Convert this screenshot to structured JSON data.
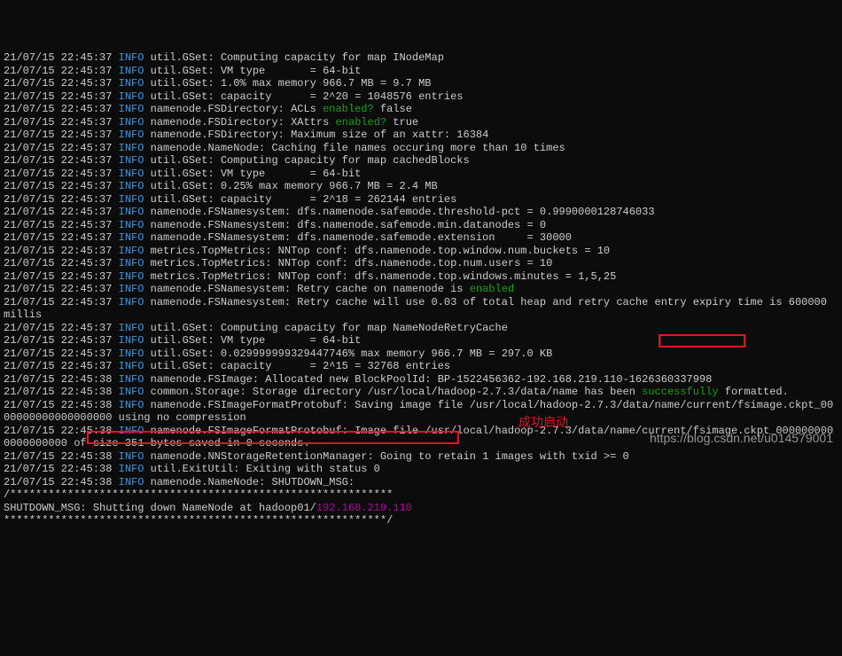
{
  "lines": [
    {
      "ts": "21/07/15 22:45:37",
      "lvl": "INFO",
      "msg": "util.GSet: Computing capacity for map INodeMap"
    },
    {
      "ts": "21/07/15 22:45:37",
      "lvl": "INFO",
      "msg": "util.GSet: VM type       = 64-bit"
    },
    {
      "ts": "21/07/15 22:45:37",
      "lvl": "INFO",
      "msg": "util.GSet: 1.0% max memory 966.7 MB = 9.7 MB"
    },
    {
      "ts": "21/07/15 22:45:37",
      "lvl": "INFO",
      "msg": "util.GSet: capacity      = 2^20 = 1048576 entries"
    },
    {
      "ts": "21/07/15 22:45:37",
      "lvl": "INFO",
      "msg_parts": [
        "namenode.FSDirectory: ACLs ",
        {
          "kw": "enabled?"
        },
        " false"
      ]
    },
    {
      "ts": "21/07/15 22:45:37",
      "lvl": "INFO",
      "msg_parts": [
        "namenode.FSDirectory: XAttrs ",
        {
          "kw": "enabled?"
        },
        " true"
      ]
    },
    {
      "ts": "21/07/15 22:45:37",
      "lvl": "INFO",
      "msg": "namenode.FSDirectory: Maximum size of an xattr: 16384"
    },
    {
      "ts": "21/07/15 22:45:37",
      "lvl": "INFO",
      "msg": "namenode.NameNode: Caching file names occuring more than 10 times"
    },
    {
      "ts": "21/07/15 22:45:37",
      "lvl": "INFO",
      "msg": "util.GSet: Computing capacity for map cachedBlocks"
    },
    {
      "ts": "21/07/15 22:45:37",
      "lvl": "INFO",
      "msg": "util.GSet: VM type       = 64-bit"
    },
    {
      "ts": "21/07/15 22:45:37",
      "lvl": "INFO",
      "msg": "util.GSet: 0.25% max memory 966.7 MB = 2.4 MB"
    },
    {
      "ts": "21/07/15 22:45:37",
      "lvl": "INFO",
      "msg": "util.GSet: capacity      = 2^18 = 262144 entries"
    },
    {
      "ts": "21/07/15 22:45:37",
      "lvl": "INFO",
      "msg": "namenode.FSNamesystem: dfs.namenode.safemode.threshold-pct = 0.9990000128746033"
    },
    {
      "ts": "21/07/15 22:45:37",
      "lvl": "INFO",
      "msg": "namenode.FSNamesystem: dfs.namenode.safemode.min.datanodes = 0"
    },
    {
      "ts": "21/07/15 22:45:37",
      "lvl": "INFO",
      "msg": "namenode.FSNamesystem: dfs.namenode.safemode.extension     = 30000"
    },
    {
      "ts": "21/07/15 22:45:37",
      "lvl": "INFO",
      "msg": "metrics.TopMetrics: NNTop conf: dfs.namenode.top.window.num.buckets = 10"
    },
    {
      "ts": "21/07/15 22:45:37",
      "lvl": "INFO",
      "msg": "metrics.TopMetrics: NNTop conf: dfs.namenode.top.num.users = 10"
    },
    {
      "ts": "21/07/15 22:45:37",
      "lvl": "INFO",
      "msg": "metrics.TopMetrics: NNTop conf: dfs.namenode.top.windows.minutes = 1,5,25"
    },
    {
      "ts": "21/07/15 22:45:37",
      "lvl": "INFO",
      "msg_parts": [
        "namenode.FSNamesystem: Retry cache on namenode is ",
        {
          "kw": "enabled"
        }
      ]
    },
    {
      "ts": "21/07/15 22:45:37",
      "lvl": "INFO",
      "msg": "namenode.FSNamesystem: Retry cache will use 0.03 of total heap and retry cache entry expiry time is 600000 millis"
    },
    {
      "ts": "21/07/15 22:45:37",
      "lvl": "INFO",
      "msg": "util.GSet: Computing capacity for map NameNodeRetryCache"
    },
    {
      "ts": "21/07/15 22:45:37",
      "lvl": "INFO",
      "msg": "util.GSet: VM type       = 64-bit"
    },
    {
      "ts": "21/07/15 22:45:37",
      "lvl": "INFO",
      "msg": "util.GSet: 0.029999999329447746% max memory 966.7 MB = 297.0 KB"
    },
    {
      "ts": "21/07/15 22:45:37",
      "lvl": "INFO",
      "msg": "util.GSet: capacity      = 2^15 = 32768 entries"
    },
    {
      "ts": "21/07/15 22:45:38",
      "lvl": "INFO",
      "msg": "namenode.FSImage: Allocated new BlockPoolId: BP-1522456362-192.168.219.110-1626360337998"
    },
    {
      "ts": "21/07/15 22:45:38",
      "lvl": "INFO",
      "msg_parts": [
        "common.Storage: Storage directory /usr/local/hadoop-2.7.3/data/name has been ",
        {
          "kw": "successfully"
        },
        " formatted."
      ]
    },
    {
      "ts": "21/07/15 22:45:38",
      "lvl": "INFO",
      "msg": "namenode.FSImageFormatProtobuf: Saving image file /usr/local/hadoop-2.7.3/data/name/current/fsimage.ckpt_0000000000000000000 using no compression"
    },
    {
      "ts": "21/07/15 22:45:38",
      "lvl": "INFO",
      "msg": "namenode.FSImageFormatProtobuf: Image file /usr/local/hadoop-2.7.3/data/name/current/fsimage.ckpt_0000000000000000000 of size 351 bytes saved in 0 seconds."
    },
    {
      "ts": "21/07/15 22:45:38",
      "lvl": "INFO",
      "msg": "namenode.NNStorageRetentionManager: Going to retain 1 images with txid >= 0"
    },
    {
      "ts": "21/07/15 22:45:38",
      "lvl": "INFO",
      "msg": "util.ExitUtil: Exiting with status 0"
    },
    {
      "ts": "21/07/15 22:45:38",
      "lvl": "INFO",
      "msg": "namenode.NameNode: SHUTDOWN_MSG:"
    }
  ],
  "sep1": "/************************************************************",
  "shutdown_label": "SHUTDOWN_MSG: ",
  "shutdown_msg": "Shutting down NameNode at hadoop01/",
  "shutdown_ip": "192.168.219.110",
  "sep2": "************************************************************/",
  "annotation": "成功启动",
  "watermark": "https://blog.csdn.net/u014579001"
}
